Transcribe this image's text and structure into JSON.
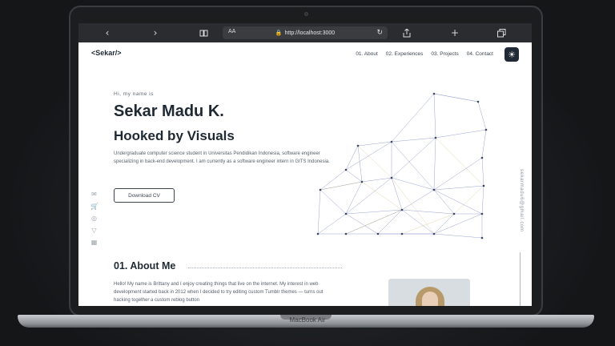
{
  "device": {
    "brand": "MacBook Air"
  },
  "browser": {
    "text_size_label": "AA",
    "url": "http://localhost:3000"
  },
  "site": {
    "logo": "<Sekar/>",
    "nav": [
      "01. About",
      "02. Experiences",
      "03. Projects",
      "04. Contact"
    ],
    "hero": {
      "greeting": "Hi, my name is",
      "name": "Sekar Madu K.",
      "tagline": "Hooked by Visuals",
      "intro": "Undergraduate computer science student in Universitas Pendidikan Indonesia, software engineer specializing in back-end development. I am currently as a software engineer intern in GITS Indonesia.",
      "download_label": "Download CV"
    },
    "side_email": "sekarmadu6@gmail.com",
    "socials": [
      "mail-icon",
      "cart-icon",
      "instagram-icon",
      "figma-icon",
      "linkedin-icon"
    ],
    "about": {
      "title": "01. About Me",
      "text": "Hello! My name is Brittany and I enjoy creating things that live on the internet. My interest in web development started back in 2012 when I decided to try editing custom Tumblr themes — turns out hacking together a custom reblog button"
    }
  },
  "colors": {
    "accent_dark": "#1f2933",
    "browser_chrome": "#2b2c2f"
  }
}
